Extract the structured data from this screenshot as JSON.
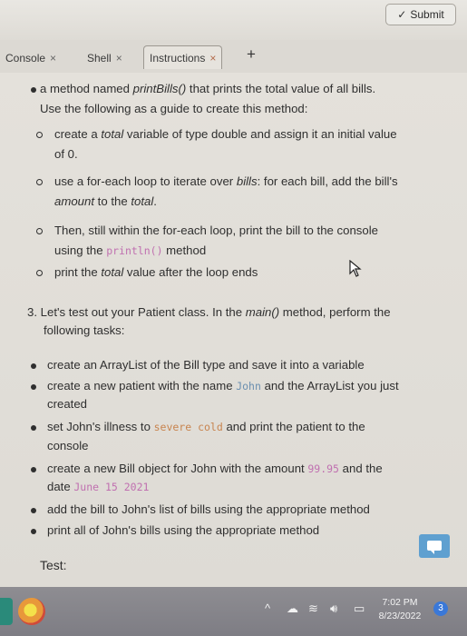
{
  "toolbar": {
    "submit_label": "Submit"
  },
  "tabs": [
    {
      "label": "Console"
    },
    {
      "label": "Shell"
    },
    {
      "label": "Instructions"
    }
  ],
  "instructions": {
    "item_print_bills": {
      "pre": "a method named ",
      "method": "printBills()",
      "post": " that prints the total value of all bills.",
      "line2": "Use the following as a guide to create this method:"
    },
    "sub1": {
      "pre": "create a ",
      "em": "total",
      "post": " variable of type double and assign it an initial value",
      "line2": "of 0."
    },
    "sub2": {
      "pre": "use a for-each loop to iterate over ",
      "em": "bills",
      "post": ": for each bill, add the bill's",
      "line2_em": "amount",
      "line2_mid": " to the ",
      "line2_em2": "total",
      "line2_post": "."
    },
    "sub3": {
      "line1": "Then, still within the for-each loop, print the bill to the console",
      "line2_pre": "using the ",
      "code": "println()",
      "line2_post": " method"
    },
    "sub4": {
      "pre": "print the ",
      "em": "total",
      "post": " value after the loop ends"
    },
    "step3": {
      "line1_pre": "3. Let's test out your Patient class. In the ",
      "method": "main()",
      "line1_post": " method, perform the",
      "line2": "following tasks:"
    },
    "task1": "create an ArrayList of the Bill type and save it into a variable",
    "task2": {
      "pre": "create a new patient with the name ",
      "code": "John",
      "post": " and the ArrayList you just",
      "line2": "created"
    },
    "task3": {
      "pre": "set John's illness to ",
      "code": "severe cold",
      "post": " and print the patient to the",
      "line2": "console"
    },
    "task4": {
      "pre": "create a new Bill object for John with the amount ",
      "code": "99.95",
      "post": " and the",
      "line2_pre": "date ",
      "line2_code": "June 15 2021"
    },
    "task5": "add the bill to John's list of bills using the appropriate method",
    "task6": "print all of John's bills using the appropriate method",
    "test_label": "Test:"
  },
  "taskbar": {
    "time": "7:02 PM",
    "date": "8/23/2022",
    "notification_count": "3"
  }
}
